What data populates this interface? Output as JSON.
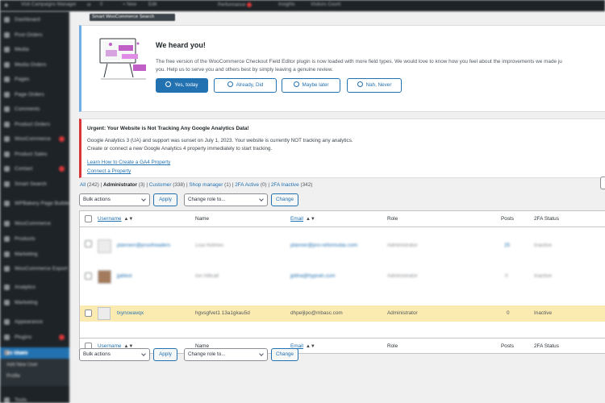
{
  "admin_bar": {
    "items": [
      "",
      "Visit Campaigns Manager",
      "",
      "0",
      "+ New",
      "Edit",
      "Performance",
      "",
      "Insights",
      "Visitors Count"
    ]
  },
  "sidebar": {
    "items": [
      {
        "label": "Dashboard"
      },
      {
        "label": "Post Orders"
      },
      {
        "label": "Media"
      },
      {
        "label": "Media Orders"
      },
      {
        "label": "Pages"
      },
      {
        "label": "Page Orders"
      },
      {
        "label": "Comments"
      },
      {
        "label": "Product Orders"
      },
      {
        "label": "WooCommerce",
        "badge": true
      },
      {
        "label": "Product Sales"
      },
      {
        "label": "Contact",
        "badge": true
      },
      {
        "label": "Smart Search"
      },
      {
        "label": "WPBakery Page Builder"
      },
      {
        "label": "WooCommerce"
      },
      {
        "label": "Products"
      },
      {
        "label": "Marketing"
      },
      {
        "label": "WooCommerce Export"
      },
      {
        "label": "Analytics"
      },
      {
        "label": "Marketing"
      },
      {
        "label": "Appearance"
      },
      {
        "label": "Plugins",
        "badge": true
      },
      {
        "label": "Users",
        "active": true
      },
      {
        "label": "Tools"
      }
    ],
    "submenu": [
      "All Users",
      "Add New User",
      "Profile"
    ]
  },
  "content": {
    "search_label": "Smart WooCommerce Search"
  },
  "notice1": {
    "title": "We heard you!",
    "text_line1": "The free version of the WooCommerce Checkout Field Editor plugin is now loaded with more field types. We would love to know how you feel about the improvements we made ju",
    "text_line2": "you. Help us to serve you and others best by simply leaving a genuine review.",
    "buttons": [
      "Yes, today",
      "Already, Did",
      "Maybe later",
      "Nah, Never"
    ]
  },
  "notice2": {
    "title": "Urgent: Your Website is Not Tracking Any Google Analytics Data!",
    "line1": "Google Analytics 3 (UA) and support was sunset on July 1, 2023. Your website is currently NOT tracking any analytics.",
    "line2": "Create or connect a new Google Analytics 4 property immediately to start tracking.",
    "link1": "Learn How to Create a GA4 Property",
    "link2": "Connect a Property"
  },
  "filters": {
    "all": "All",
    "all_count": "(242)",
    "administrator": "Administrator",
    "administrator_count": "(3)",
    "customer": "Customer",
    "customer_count": "(338)",
    "shop_manager": "Shop manager",
    "shop_manager_count": "(1)",
    "twofa_active": "2FA Active",
    "twofa_active_count": "(0)",
    "twofa_inactive": "2FA Inactive",
    "twofa_inactive_count": "(342)",
    "sep": "|"
  },
  "actions": {
    "bulk_label": "Bulk actions",
    "apply_label": "Apply",
    "role_label": "Change role to...",
    "change_label": "Change"
  },
  "table": {
    "columns": {
      "username": "Username",
      "name": "Name",
      "email": "Email",
      "role": "Role",
      "posts": "Posts",
      "twofa": "2FA Status"
    },
    "sort_arrow": "▲▼",
    "rows": [
      {
        "username": "plannerr@proofreaders",
        "name": "Lisa Holmes",
        "email": "planner@pro-reformulas.com",
        "role": "Administrator",
        "posts": "25",
        "twofa": "Inactive"
      },
      {
        "username": "jjabkot",
        "name": "Ion Hillcall",
        "email": "jpbha@hyprah.com",
        "role": "Administrator",
        "posts": "0",
        "twofa": "Inactive"
      },
      {
        "username": "txyncwavqx",
        "name": "hgvsgfvet1 13a1gkau5d",
        "email": "dhpeljlpo@mbasc.com",
        "role": "Administrator",
        "posts": "0",
        "twofa": "Inactive"
      }
    ]
  },
  "colors": {
    "accent": "#2271b1",
    "admin_dark": "#1d2327",
    "error": "#d63638",
    "highlight_row": "#fcebb1"
  }
}
